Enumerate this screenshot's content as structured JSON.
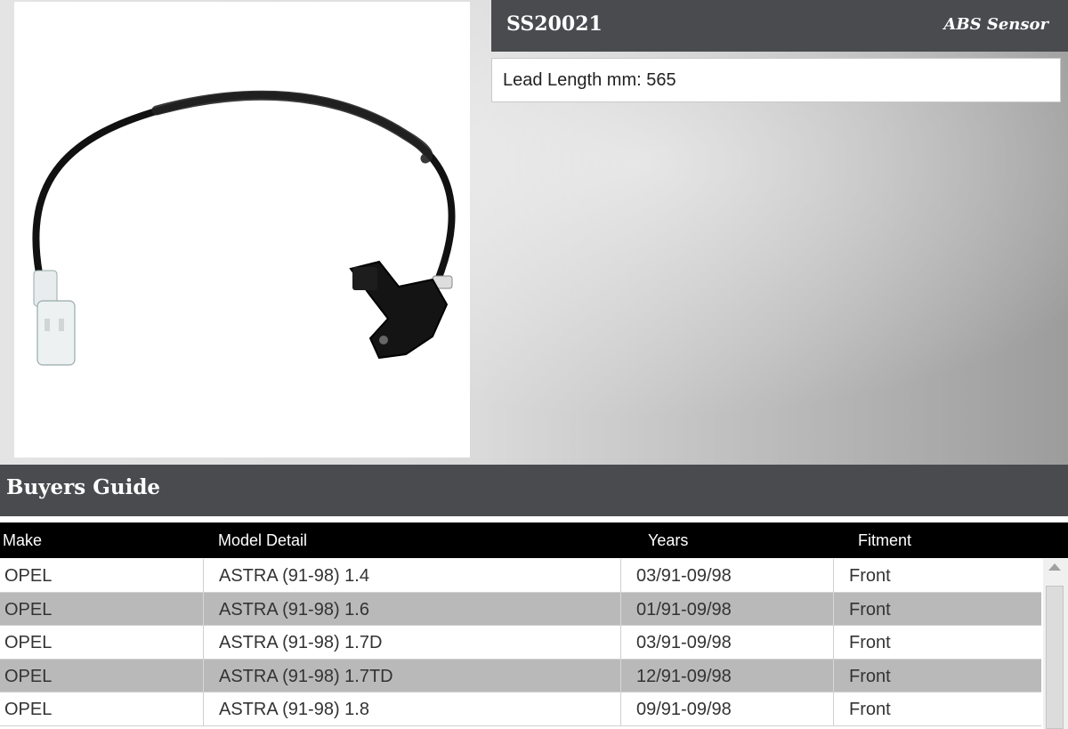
{
  "product": {
    "part_number": "SS20021",
    "type": "ABS Sensor",
    "spec_label": "Lead Length mm:",
    "spec_value": "565"
  },
  "buyers_guide": {
    "title": "Buyers Guide",
    "columns": [
      "Make",
      "Model Detail",
      "Years",
      "Fitment"
    ],
    "rows": [
      {
        "make": "OPEL",
        "model": "ASTRA (91-98) 1.4",
        "years": "03/91-09/98",
        "fitment": "Front"
      },
      {
        "make": "OPEL",
        "model": "ASTRA (91-98) 1.6",
        "years": "01/91-09/98",
        "fitment": "Front"
      },
      {
        "make": "OPEL",
        "model": "ASTRA (91-98) 1.7D",
        "years": "03/91-09/98",
        "fitment": "Front"
      },
      {
        "make": "OPEL",
        "model": "ASTRA (91-98) 1.7TD",
        "years": "12/91-09/98",
        "fitment": "Front"
      },
      {
        "make": "OPEL",
        "model": "ASTRA (91-98) 1.8",
        "years": "09/91-09/98",
        "fitment": "Front"
      }
    ]
  },
  "colors": {
    "header_bar": "#4a4b4f",
    "table_header": "#000000",
    "alt_row": "#b9b9b9"
  },
  "icons": {
    "scroll_up": "scroll-up-arrow-icon"
  }
}
